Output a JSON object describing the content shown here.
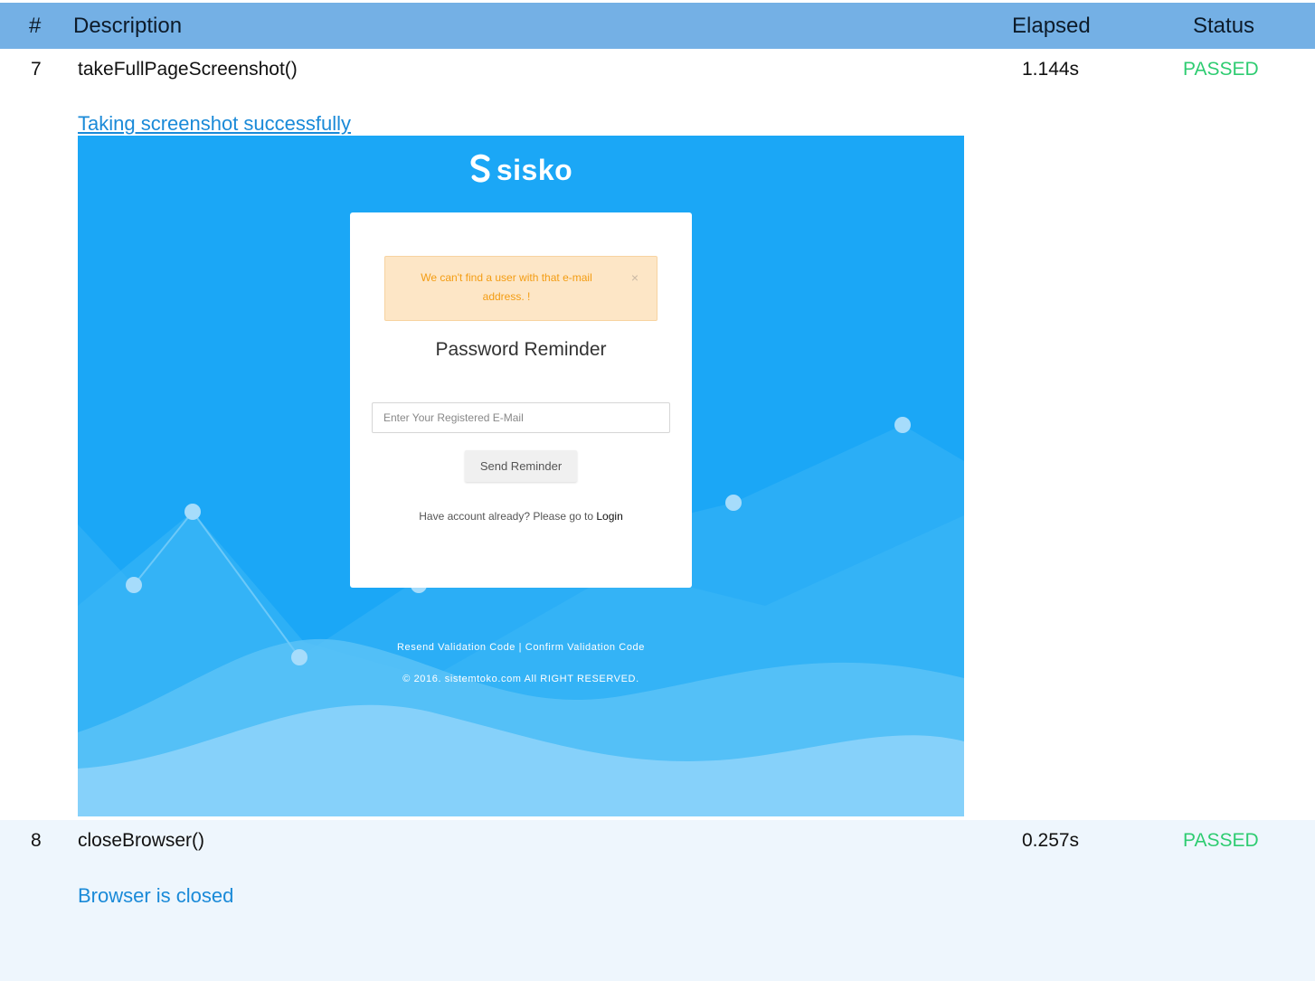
{
  "header": {
    "num": "#",
    "description": "Description",
    "elapsed": "Elapsed",
    "status": "Status"
  },
  "rows": [
    {
      "num": "7",
      "description": "takeFullPageScreenshot()",
      "elapsed": "1.144s",
      "status": "PASSED",
      "message": "Taking screenshot successfully"
    },
    {
      "num": "8",
      "description": "closeBrowser()",
      "elapsed": "0.257s",
      "status": "PASSED",
      "message": "Browser is closed"
    }
  ],
  "screenshot": {
    "logo_text": "sisko",
    "alert_text": "We can't find a user with that e-mail address. !",
    "alert_close": "×",
    "title": "Password Reminder",
    "email_placeholder": "Enter Your Registered E-Mail",
    "send_button": "Send Reminder",
    "have_account": "Have account already? Please go to ",
    "login_link": "Login",
    "footer_links": "Resend Validation Code | Confirm Validation Code",
    "copyright": "© 2016. sistemtoko.com All RIGHT RESERVED."
  },
  "colors": {
    "header_bg": "#74b0e5",
    "passed": "#2ecc71",
    "message": "#1a8ad8",
    "screenshot_bg": "#1ba7f6",
    "alert_bg": "#fde6c6",
    "alert_text": "#f39c12",
    "row8_bg": "#eef6fd"
  }
}
